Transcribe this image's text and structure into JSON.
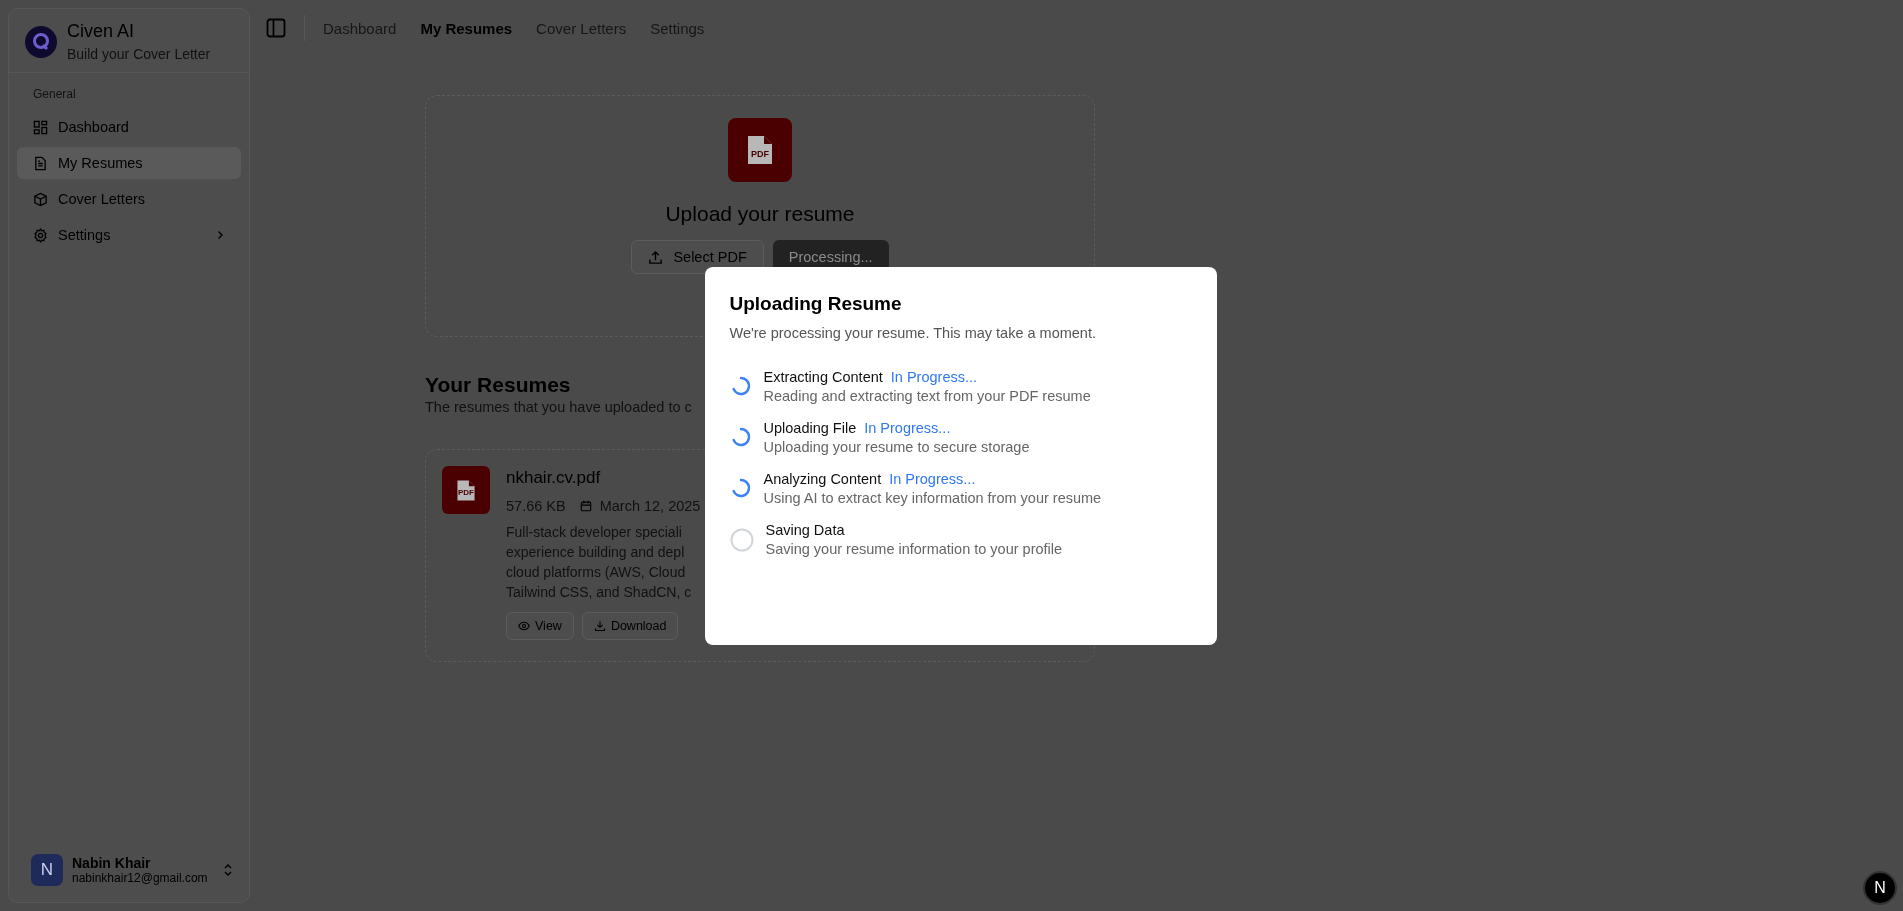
{
  "app": {
    "name": "Civen AI",
    "tagline": "Build your Cover Letter"
  },
  "sidebar": {
    "group_label": "General",
    "items": [
      {
        "label": "Dashboard",
        "selected": false
      },
      {
        "label": "My Resumes",
        "selected": true
      },
      {
        "label": "Cover Letters",
        "selected": false
      },
      {
        "label": "Settings",
        "selected": false,
        "expanded": false
      }
    ],
    "user": {
      "initial": "N",
      "name": "Nabin Khair",
      "email": "nabinkhair12@gmail.com"
    }
  },
  "nav": [
    {
      "label": "Dashboard",
      "selected": false
    },
    {
      "label": "My Resumes",
      "selected": true
    },
    {
      "label": "Cover Letters",
      "selected": false
    },
    {
      "label": "Settings",
      "selected": false
    }
  ],
  "upload": {
    "icon_label": "PDF",
    "title": "Upload your resume",
    "select_button": "Select PDF",
    "process_button": "Processing...",
    "process_disabled": true
  },
  "resumes": {
    "title": "Your Resumes",
    "subtitle": "The resumes that you have uploaded to c",
    "items": [
      {
        "icon_label": "PDF",
        "filename": "nkhair.cv.pdf",
        "size": "57.66 KB",
        "date": "March 12, 2025",
        "description_lines": [
          "Full-stack developer speciali",
          "experience building and depl",
          "cloud platforms (AWS, Cloud",
          "Tailwind CSS, and ShadCN, c"
        ],
        "actions": [
          "View",
          "Download"
        ]
      }
    ]
  },
  "dialog": {
    "title": "Uploading Resume",
    "description": "We're processing your resume. This may take a moment.",
    "steps": [
      {
        "title": "Extracting Content",
        "kind": "active",
        "status_label": "In Progress...",
        "description": "Reading and extracting text from your PDF resume"
      },
      {
        "title": "Uploading File",
        "kind": "active",
        "status_label": "In Progress...",
        "description": "Uploading your resume to secure storage"
      },
      {
        "title": "Analyzing Content",
        "kind": "active",
        "status_label": "In Progress...",
        "description": "Using AI to extract key information from your resume"
      },
      {
        "title": "Saving Data",
        "kind": "waiting",
        "description": "Saving your resume information to your profile"
      }
    ]
  },
  "dev_badge": "N"
}
